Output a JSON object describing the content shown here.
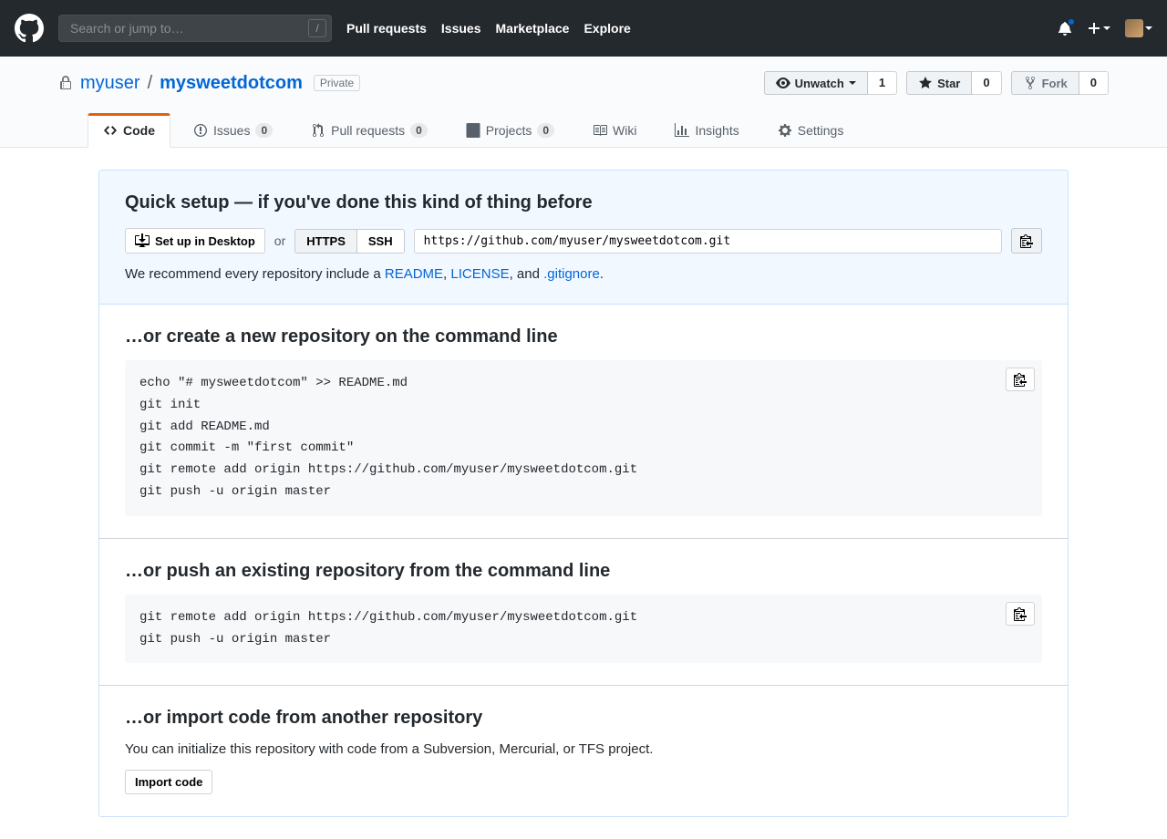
{
  "header": {
    "search_placeholder": "Search or jump to…",
    "nav": [
      "Pull requests",
      "Issues",
      "Marketplace",
      "Explore"
    ]
  },
  "repo": {
    "owner": "myuser",
    "name": "mysweetdotcom",
    "badge": "Private",
    "actions": {
      "unwatch": "Unwatch",
      "unwatch_count": "1",
      "star": "Star",
      "star_count": "0",
      "fork": "Fork",
      "fork_count": "0"
    }
  },
  "tabs": {
    "code": "Code",
    "issues": "Issues",
    "issues_count": "0",
    "pulls": "Pull requests",
    "pulls_count": "0",
    "projects": "Projects",
    "projects_count": "0",
    "wiki": "Wiki",
    "insights": "Insights",
    "settings": "Settings"
  },
  "setup": {
    "title": "Quick setup — if you've done this kind of thing before",
    "desktop_btn": "Set up in Desktop",
    "or": "or",
    "https": "HTTPS",
    "ssh": "SSH",
    "url": "https://github.com/myuser/mysweetdotcom.git",
    "recommend_prefix": "We recommend every repository include a ",
    "readme": "README",
    "license": "LICENSE",
    "and": ", and ",
    "gitignore": ".gitignore",
    "period": "."
  },
  "cli1": {
    "title": "…or create a new repository on the command line",
    "code": "echo \"# mysweetdotcom\" >> README.md\ngit init\ngit add README.md\ngit commit -m \"first commit\"\ngit remote add origin https://github.com/myuser/mysweetdotcom.git\ngit push -u origin master"
  },
  "cli2": {
    "title": "…or push an existing repository from the command line",
    "code": "git remote add origin https://github.com/myuser/mysweetdotcom.git\ngit push -u origin master"
  },
  "import": {
    "title": "…or import code from another repository",
    "desc": "You can initialize this repository with code from a Subversion, Mercurial, or TFS project.",
    "btn": "Import code"
  }
}
